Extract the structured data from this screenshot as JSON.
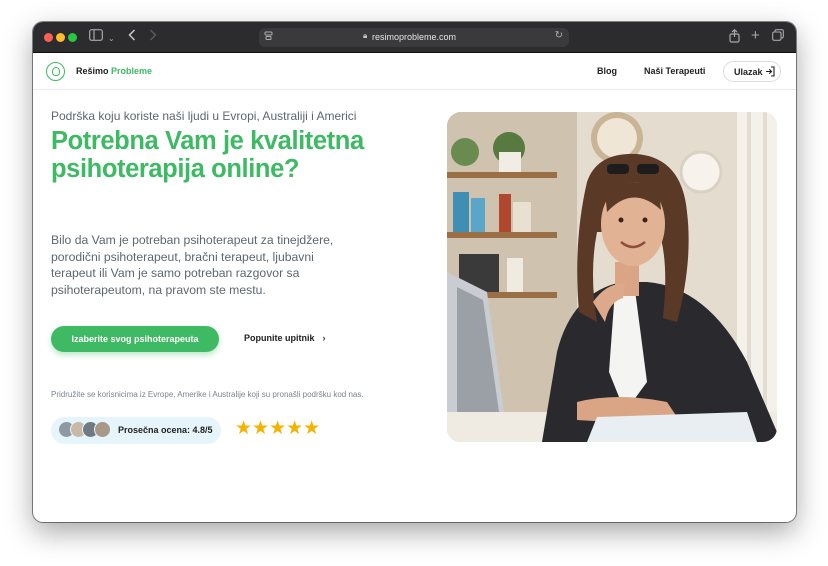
{
  "browser": {
    "url": "resimoprobleme.com"
  },
  "site": {
    "logo": {
      "name": "Rešimo",
      "accent": "Probleme"
    },
    "nav": {
      "blog": "Blog",
      "therapists": "Naši Terapeuti",
      "login": "Ulazak"
    }
  },
  "hero": {
    "eyebrow": "Podrška koju koriste naši ljudi u Evropi, Australiji i Americi",
    "headline": "Potrebna Vam je kvalitetna psihoterapija online?",
    "description": "Bilo da Vam je potreban psihoterapeut za tinejdžere, porodični psihoterapeut, bračni terapeut, ljubavni terapeut ili Vam je samo potreban razgovor sa psihoterapeutom, na pravom ste mestu.",
    "cta_primary": "Izaberite svog psihoterapeuta",
    "cta_secondary": "Popunite upitnik",
    "join_text": "Pridružite se korisnicima iz Evrope, Amerike i Australije koji su pronašli podršku kod nas.",
    "rating_text": "Prosečna ocena: 4.8/5",
    "stars": "★★★★★",
    "star_rating": 5
  },
  "colors": {
    "brand_green": "#3dba63",
    "star_gold": "#f5b301",
    "pill_bg": "#e6f4fb",
    "text_muted": "#5c6770"
  },
  "icons": {
    "logo": "brain-circle-icon",
    "login": "login-arrow-icon",
    "chevron": "chevron-right-icon"
  }
}
